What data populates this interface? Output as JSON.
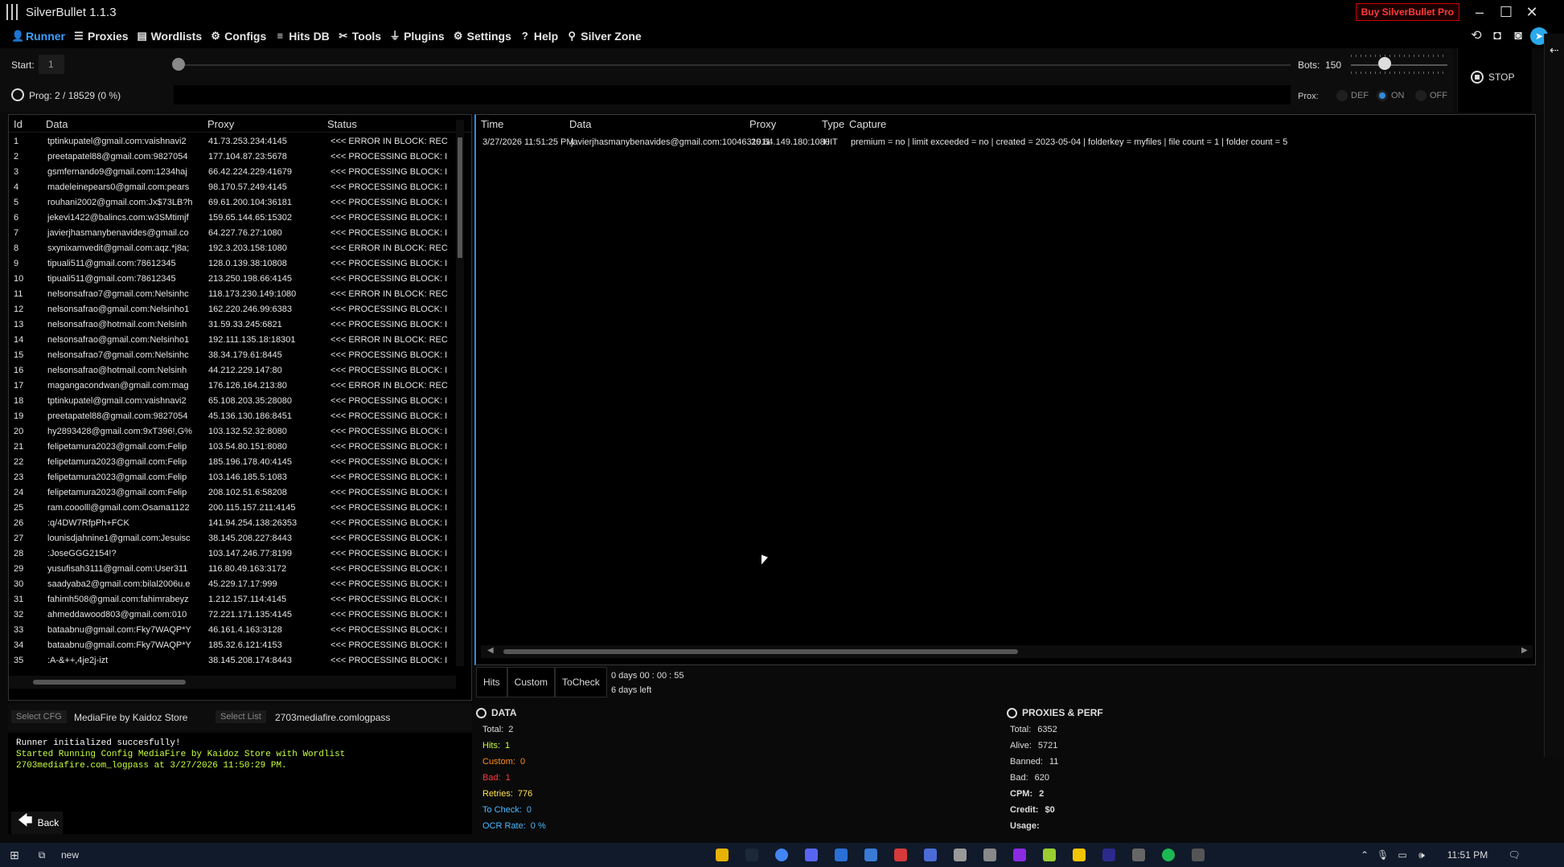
{
  "window": {
    "title": "SilverBullet 1.1.3",
    "buy_label": "Buy SilverBullet Pro",
    "min": "–",
    "max": "☐",
    "close": "✕"
  },
  "nav": [
    {
      "label": "Runner",
      "icon": "person-icon",
      "glyph": "👤"
    },
    {
      "label": "Proxies",
      "icon": "list-icon",
      "glyph": "☰"
    },
    {
      "label": "Wordlists",
      "icon": "book-icon",
      "glyph": "▤"
    },
    {
      "label": "Configs",
      "icon": "gear-icon",
      "glyph": "⚙"
    },
    {
      "label": "Hits DB",
      "icon": "database-icon",
      "glyph": "≡"
    },
    {
      "label": "Tools",
      "icon": "tools-icon",
      "glyph": "✂"
    },
    {
      "label": "Plugins",
      "icon": "plug-icon",
      "glyph": "⏚"
    },
    {
      "label": "Settings",
      "icon": "gear-icon",
      "glyph": "⚙"
    },
    {
      "label": "Help",
      "icon": "help-icon",
      "glyph": "?"
    },
    {
      "label": "Silver Zone",
      "icon": "pin-icon",
      "glyph": "⚲"
    }
  ],
  "toolbar_icons": [
    {
      "name": "history-icon",
      "glyph": "⟲"
    },
    {
      "name": "camera-icon",
      "glyph": "◘"
    },
    {
      "name": "discord-icon",
      "glyph": "◙"
    },
    {
      "name": "telegram-icon",
      "glyph": "➤"
    }
  ],
  "controls": {
    "start_label": "Start:",
    "start_value": "1",
    "start_fraction": 0,
    "bots_label": "Bots:",
    "bots_value": "150",
    "progress_text": "Prog: 2  /  18529  (0 %)",
    "prox_label": "Prox:",
    "prox_options": [
      "DEF",
      "ON",
      "OFF"
    ],
    "prox_selected": "ON",
    "stop_label": "STOP"
  },
  "data_grid": {
    "headers": [
      "Id",
      "Data",
      "Proxy",
      "Status"
    ],
    "rows": [
      [
        "1",
        "tptinkupatel@gmail.com:vaishnavi2",
        "41.73.253.234:4145",
        "<<< ERROR IN BLOCK: REC"
      ],
      [
        "2",
        "preetapatel88@gmail.com:9827054",
        "177.104.87.23:5678",
        "<<< PROCESSING BLOCK: I"
      ],
      [
        "3",
        "gsmfernando9@gmail.com:1234haj",
        "66.42.224.229:41679",
        "<<< PROCESSING BLOCK: I"
      ],
      [
        "4",
        "madeleinepears0@gmail.com:pears",
        "98.170.57.249:4145",
        "<<< PROCESSING BLOCK: I"
      ],
      [
        "5",
        "rouhani2002@gmail.com:Jx$73LB?h",
        "69.61.200.104:36181",
        "<<< PROCESSING BLOCK: I"
      ],
      [
        "6",
        "jekevi1422@balincs.com:w3SMtimjf",
        "159.65.144.65:15302",
        "<<< PROCESSING BLOCK: I"
      ],
      [
        "7",
        "javierjhasmanybenavides@gmail.co",
        "64.227.76.27:1080",
        "<<< PROCESSING BLOCK: I"
      ],
      [
        "8",
        "sxynixamvedit@gmail.com:aqz.*j8a;",
        "192.3.203.158:1080",
        "<<< ERROR IN BLOCK: REC"
      ],
      [
        "9",
        "tipuali511@gmail.com:78612345",
        "128.0.139.38:10808",
        "<<< PROCESSING BLOCK: I"
      ],
      [
        "10",
        "tipuali511@gmail.com:78612345",
        "213.250.198.66:4145",
        "<<< PROCESSING BLOCK: I"
      ],
      [
        "11",
        "nelsonsafrao7@gmail.com:Nelsinhc",
        "118.173.230.149:1080",
        "<<< ERROR IN BLOCK: REC"
      ],
      [
        "12",
        "nelsonsafrao@gmail.com:Nelsinho1",
        "162.220.246.99:6383",
        "<<< PROCESSING BLOCK: I"
      ],
      [
        "13",
        "nelsonsafrao@hotmail.com:Nelsinh",
        "31.59.33.245:6821",
        "<<< PROCESSING BLOCK: I"
      ],
      [
        "14",
        "nelsonsafrao@gmail.com:Nelsinho1",
        "192.111.135.18:18301",
        "<<< ERROR IN BLOCK: REC"
      ],
      [
        "15",
        "nelsonsafrao7@gmail.com:Nelsinhc",
        "38.34.179.61:8445",
        "<<< PROCESSING BLOCK: I"
      ],
      [
        "16",
        "nelsonsafrao@hotmail.com:Nelsinh",
        "44.212.229.147:80",
        "<<< PROCESSING BLOCK: I"
      ],
      [
        "17",
        "magangacondwan@gmail.com:mag",
        "176.126.164.213:80",
        "<<< ERROR IN BLOCK: REC"
      ],
      [
        "18",
        "tptinkupatel@gmail.com:vaishnavi2",
        "65.108.203.35:28080",
        "<<< PROCESSING BLOCK: I"
      ],
      [
        "19",
        "preetapatel88@gmail.com:9827054",
        "45.136.130.186:8451",
        "<<< PROCESSING BLOCK: I"
      ],
      [
        "20",
        "hy2893428@gmail.com:9xT396!,G%",
        "103.132.52.32:8080",
        "<<< PROCESSING BLOCK: I"
      ],
      [
        "21",
        "felipetamura2023@gmail.com:Felip",
        "103.54.80.151:8080",
        "<<< PROCESSING BLOCK: I"
      ],
      [
        "22",
        "felipetamura2023@gmail.com:Felip",
        "185.196.178.40:4145",
        "<<< PROCESSING BLOCK: I"
      ],
      [
        "23",
        "felipetamura2023@gmail.com:Felip",
        "103.146.185.5:1083",
        "<<< PROCESSING BLOCK: I"
      ],
      [
        "24",
        "felipetamura2023@gmail.com:Felip",
        "208.102.51.6:58208",
        "<<< PROCESSING BLOCK: I"
      ],
      [
        "25",
        "ram.cooolll@gmail.com:Osama1122",
        "200.115.157.211:4145",
        "<<< PROCESSING BLOCK: I"
      ],
      [
        "26",
        ":q/4DW7RfpPh+FCK",
        "141.94.254.138:26353",
        "<<< PROCESSING BLOCK: I"
      ],
      [
        "27",
        "lounisdjahnine1@gmail.com:Jesuisc",
        "38.145.208.227:8443",
        "<<< PROCESSING BLOCK: I"
      ],
      [
        "28",
        ":JoseGGG2154!?",
        "103.147.246.77:8199",
        "<<< PROCESSING BLOCK: I"
      ],
      [
        "29",
        "yusufisah3111@gmail.com:User311",
        "116.80.49.163:3172",
        "<<< PROCESSING BLOCK: I"
      ],
      [
        "30",
        "saadyaba2@gmail.com:bilal2006u.e",
        "45.229.17.17:999",
        "<<< PROCESSING BLOCK: I"
      ],
      [
        "31",
        "fahimh508@gmail.com:fahimrabeyz",
        "1.212.157.114:4145",
        "<<< PROCESSING BLOCK: I"
      ],
      [
        "32",
        "ahmeddawood803@gmail.com:010",
        "72.221.171.135:4145",
        "<<< PROCESSING BLOCK: I"
      ],
      [
        "33",
        "bataabnu@gmail.com:Fky7WAQP*Y",
        "46.161.4.163:3128",
        "<<< PROCESSING BLOCK: I"
      ],
      [
        "34",
        "bataabnu@gmail.com:Fky7WAQP*Y",
        "185.32.6.121:4153",
        "<<< PROCESSING BLOCK: I"
      ],
      [
        "35",
        ":A-&++,4je2j-izt",
        "38.145.208.174:8443",
        "<<< PROCESSING BLOCK: I"
      ]
    ]
  },
  "hits_grid": {
    "headers": [
      "Time",
      "Data",
      "Proxy",
      "Type",
      "Capture"
    ],
    "rows": [
      [
        "3/27/2026 11:51:25 PM",
        "javierjhasmanybenavides@gmail.com:1004631911",
        "20.64.149.180:1080",
        "HIT",
        "premium = no | limit exceeded = no | created = 2023-05-04 | folderkey = myfiles | file count = 1 | folder count = 5"
      ]
    ]
  },
  "tabs": [
    "Hits",
    "Custom",
    "ToCheck"
  ],
  "timer": {
    "elapsed": "0  days  00 : 00 : 55",
    "left": "6 days left"
  },
  "config_row": {
    "select_cfg": "Select CFG",
    "cfg_name": "MediaFire by Kaidoz Store",
    "select_list": "Select List",
    "list_name": "2703mediafire.comlogpass"
  },
  "log": [
    {
      "text": "Runner initialized succesfully!",
      "color": "white"
    },
    {
      "text": "Started Running Config MediaFire by Kaidoz Store with Wordlist",
      "color": "green"
    },
    {
      "text": "2703mediafire.com_logpass at 3/27/2026 11:50:29 PM.",
      "color": "green"
    }
  ],
  "back_label": "Back",
  "data_stats": {
    "title": "DATA",
    "items": [
      {
        "label": "Total:",
        "value": "2",
        "color": "#dddddd"
      },
      {
        "label": "Hits:",
        "value": "1",
        "color": "#c7ff3d"
      },
      {
        "label": "Custom:",
        "value": "0",
        "color": "#ff8c1a"
      },
      {
        "label": "Bad:",
        "value": "1",
        "color": "#ff3b3b"
      },
      {
        "label": "Retries:",
        "value": "776",
        "color": "#ffe44d"
      },
      {
        "label": "To Check:",
        "value": "0",
        "color": "#4db8ff"
      },
      {
        "label": "OCR Rate:",
        "value": "0 %",
        "color": "#4db8ff"
      }
    ]
  },
  "proxy_stats": {
    "title": "PROXIES & PERF",
    "items": [
      {
        "label": "Total:",
        "value": "6352"
      },
      {
        "label": "Alive:",
        "value": "5721"
      },
      {
        "label": "Banned:",
        "value": "11"
      },
      {
        "label": "Bad:",
        "value": "620"
      },
      {
        "label": "CPM:",
        "value": "2"
      },
      {
        "label": "Credit:",
        "value": "$0"
      },
      {
        "label": "Usage:",
        "value": ""
      }
    ]
  },
  "taskbar": {
    "search_text": "new",
    "clock": "11:51 PM",
    "apps": [
      "file-explorer-icon",
      "steam-icon",
      "chrome-icon",
      "discord-icon",
      "app-icon",
      "app-icon",
      "app-icon",
      "app-icon",
      "app-icon",
      "app-icon",
      "app-icon",
      "notepad-icon",
      "app-icon",
      "premiere-icon",
      "app-icon",
      "spotify-icon",
      "silverbullet-icon"
    ]
  }
}
